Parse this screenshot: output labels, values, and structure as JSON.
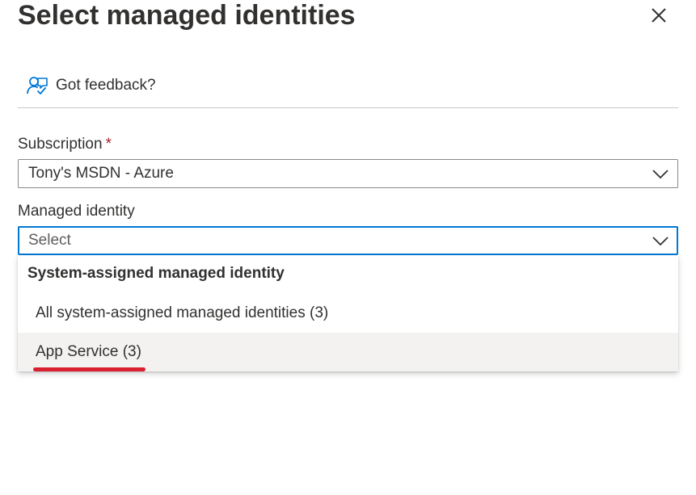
{
  "panel": {
    "title": "Select managed identities"
  },
  "feedback": {
    "label": "Got feedback?"
  },
  "subscription": {
    "label": "Subscription",
    "required_marker": "*",
    "value": "Tony's MSDN - Azure"
  },
  "managed_identity": {
    "label": "Managed identity",
    "placeholder": "Select",
    "menu": {
      "group_header": "System-assigned managed identity",
      "options": [
        {
          "label": "All system-assigned managed identities (3)"
        },
        {
          "label": "App Service (3)"
        }
      ]
    }
  },
  "icons": {
    "close": "close-icon",
    "feedback": "feedback-icon",
    "chevron": "chevron-down-icon"
  },
  "colors": {
    "accent": "#0078d4",
    "required": "#a4262c",
    "highlight_underline": "#d9202f",
    "hover_background": "#f3f2f1"
  }
}
